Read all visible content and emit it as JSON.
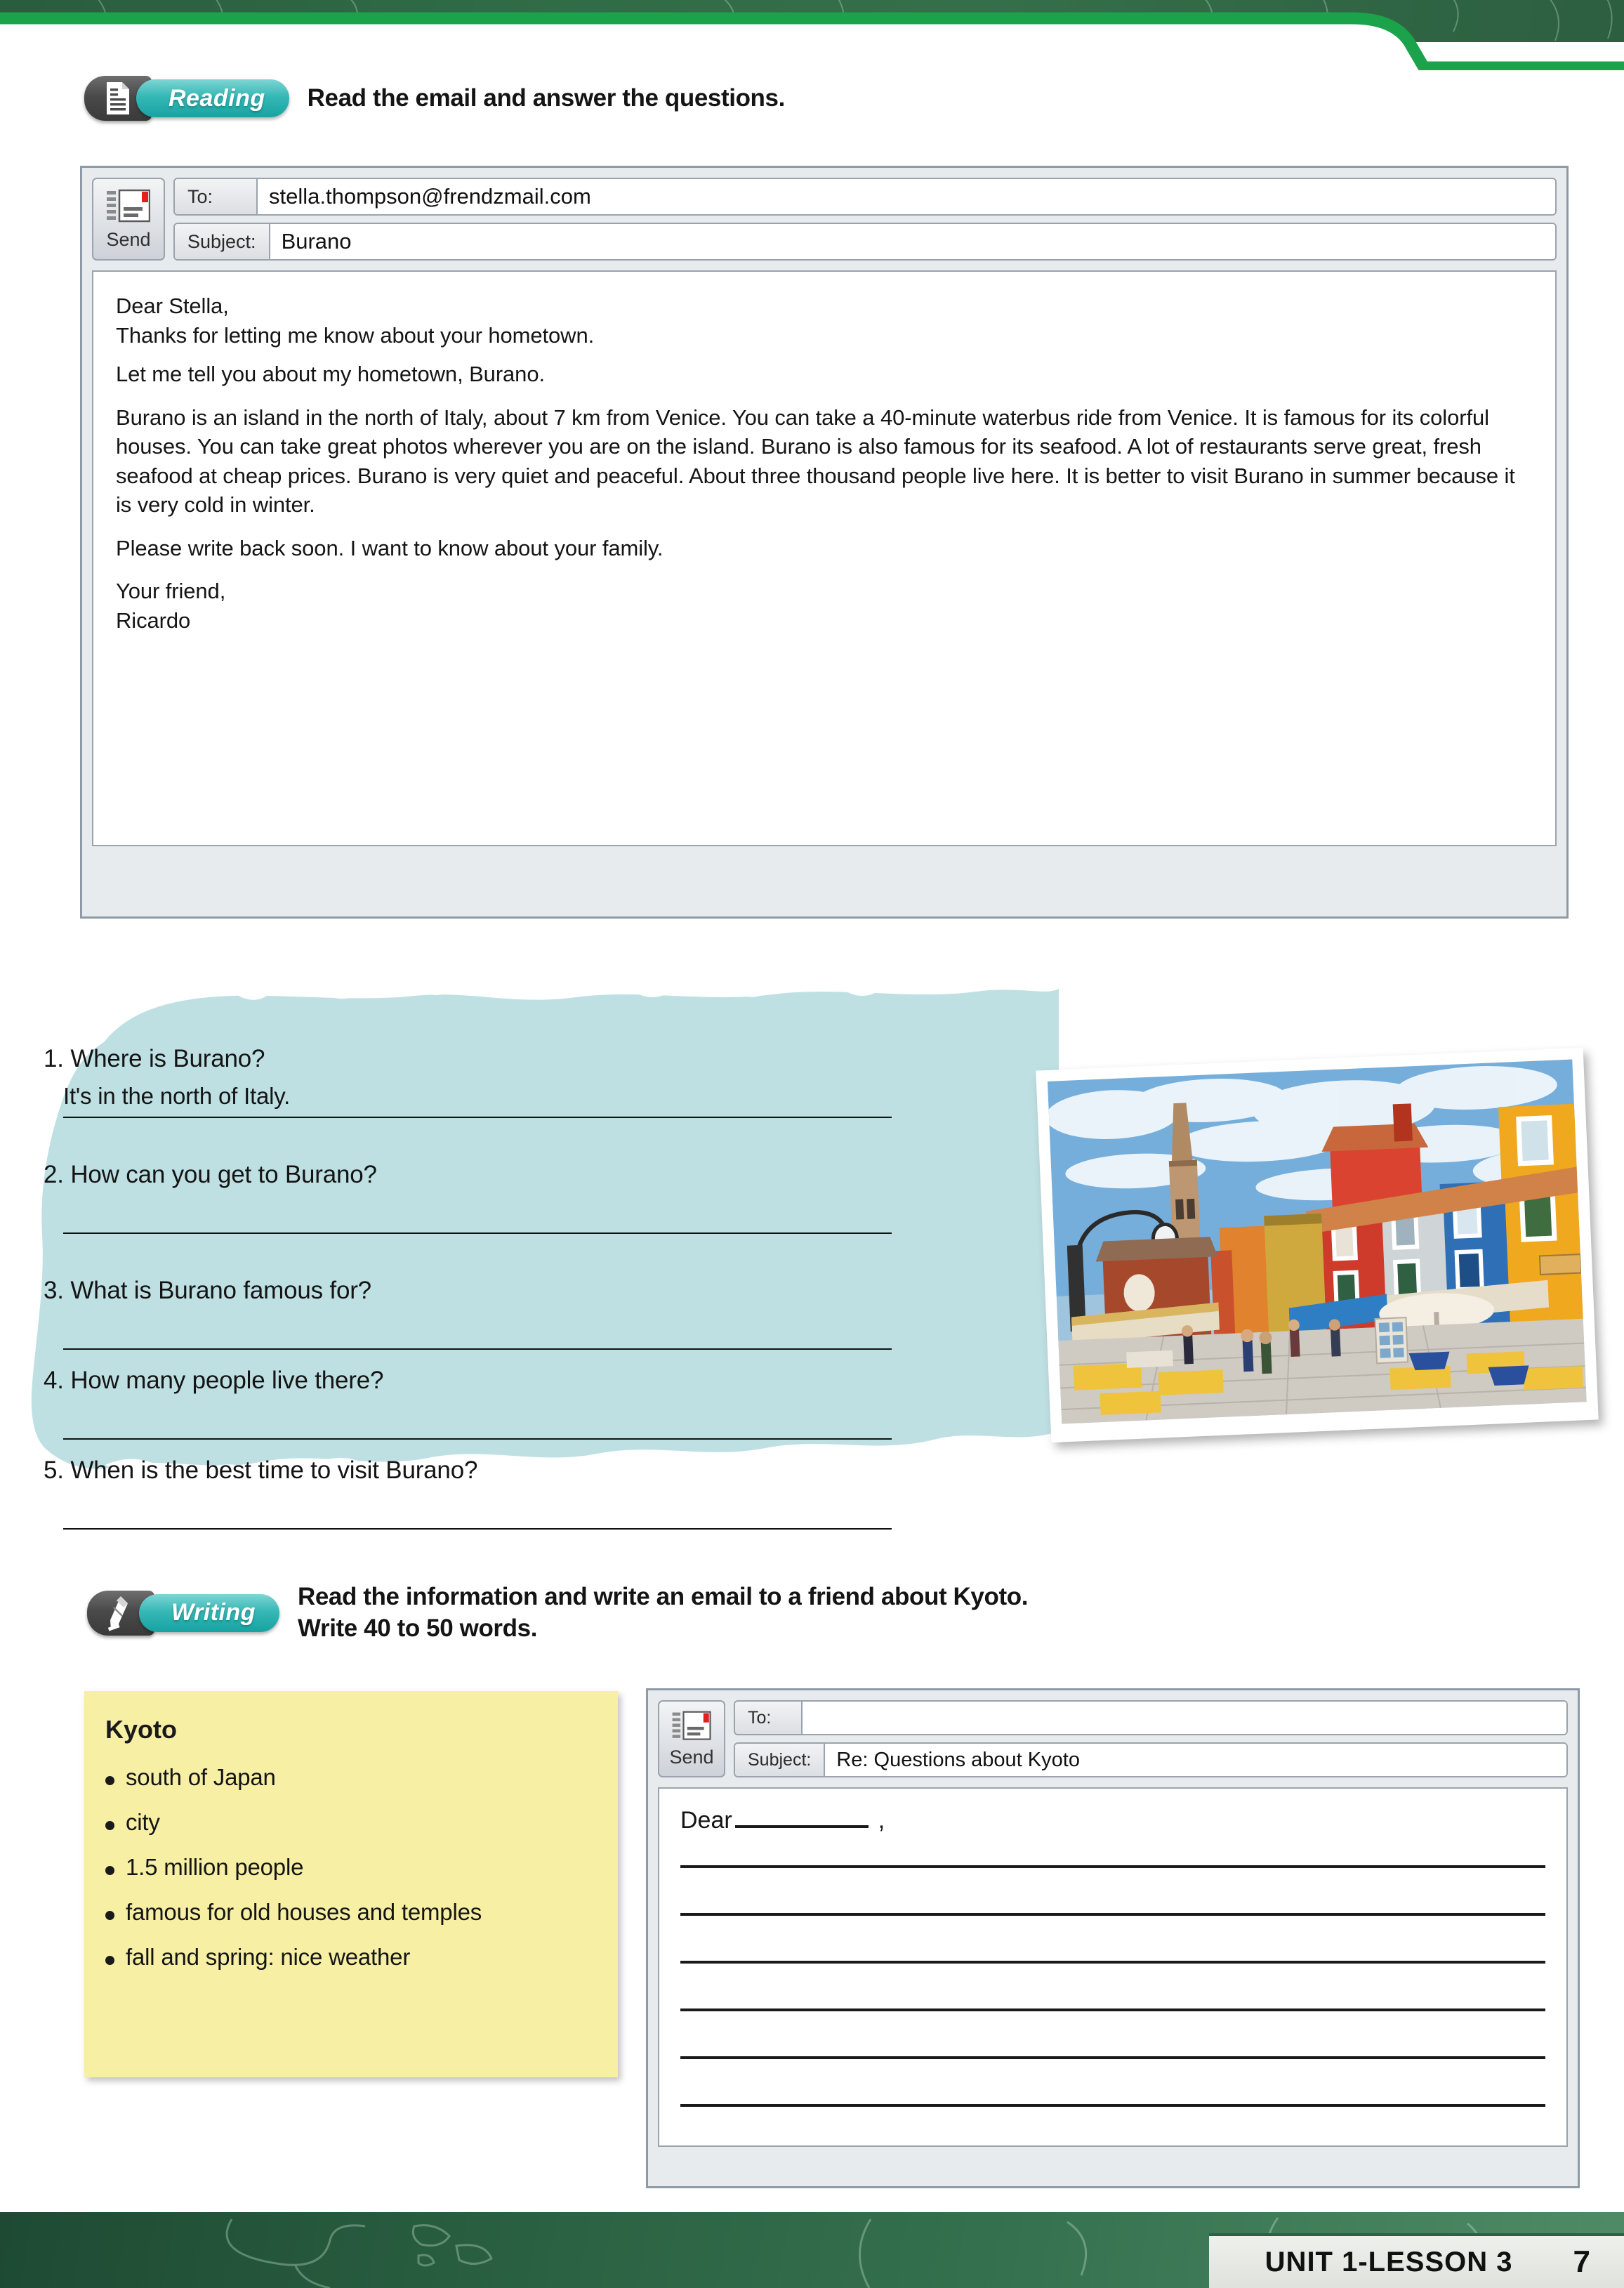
{
  "header": {
    "decor": "world-map-outline-band"
  },
  "reading": {
    "badge_label": "Reading",
    "badge_icon": "document-icon",
    "instruction": "Read the email and answer the questions."
  },
  "email_read": {
    "send_label": "Send",
    "send_icon": "envelope-icon",
    "to_label": "To:",
    "to_value": "stella.thompson@frendzmail.com",
    "subject_label": "Subject:",
    "subject_value": "Burano",
    "body": {
      "greeting": "Dear Stella,",
      "line1": "Thanks for letting me know about your hometown.",
      "line2": "Let me tell you about my hometown, Burano.",
      "paragraph": "Burano is an island in the north of Italy, about 7 km from Venice. You can take a 40-minute waterbus ride from Venice. It is famous for its colorful houses. You can take great photos wherever you are on the island. Burano is also famous for its seafood. A lot of restaurants serve great, fresh seafood at cheap prices. Burano is very quiet and peaceful. About three thousand people live here. It is better to visit Burano in summer because it is very cold in winter.",
      "closing_request": "Please write back soon. I want to know about your family.",
      "signoff": "Your friend,",
      "sender": "Ricardo"
    }
  },
  "questions": [
    {
      "number": "1.",
      "text": "Where is Burano?",
      "answer": "It's in the north of Italy."
    },
    {
      "number": "2.",
      "text": "How can you get to Burano?",
      "answer": ""
    },
    {
      "number": "3.",
      "text": "What is Burano famous for?",
      "answer": ""
    },
    {
      "number": "4.",
      "text": "How many people live there?",
      "answer": ""
    },
    {
      "number": "5.",
      "text": "When is the best time to visit Burano?",
      "answer": ""
    }
  ],
  "photo": {
    "caption_alt": "Burano colorful street with bell tower, shops and cafe tables"
  },
  "writing": {
    "badge_label": "Writing",
    "badge_icon": "pencil-icon",
    "instruction_line1": "Read the information and write an email to a friend about Kyoto.",
    "instruction_line2": "Write 40 to 50 words."
  },
  "kyoto_note": {
    "title": "Kyoto",
    "items": [
      "south of Japan",
      "city",
      "1.5 million people",
      "famous for old houses and temples",
      "fall and spring: nice weather"
    ]
  },
  "email_write": {
    "send_label": "Send",
    "send_icon": "envelope-icon",
    "to_label": "To:",
    "to_value": "",
    "subject_label": "Subject:",
    "subject_value": "Re: Questions about Kyoto",
    "dear_word": "Dear",
    "dear_comma": ","
  },
  "footer": {
    "unit": "UNIT 1-LESSON 3",
    "page": "7"
  },
  "colors": {
    "teal_accent": "#17a3a1",
    "brush_blue": "#bfe0e3",
    "note_yellow": "#f7f0a4",
    "footer_green": "#2b6243",
    "header_green": "#2f6b46"
  }
}
